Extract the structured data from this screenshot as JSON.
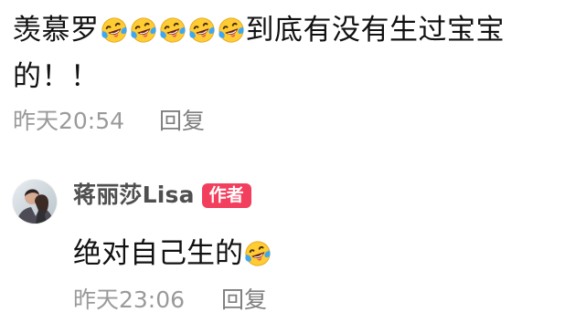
{
  "parent_comment": {
    "segments": [
      {
        "type": "text",
        "value": "羡慕罗"
      },
      {
        "type": "emoji",
        "icon": "laughing-tears-emoji"
      },
      {
        "type": "emoji",
        "icon": "laughing-tears-emoji"
      },
      {
        "type": "emoji",
        "icon": "laughing-tears-emoji"
      },
      {
        "type": "emoji",
        "icon": "laughing-tears-emoji"
      },
      {
        "type": "emoji",
        "icon": "laughing-tears-emoji"
      },
      {
        "type": "text",
        "value": "到底有没有生过宝宝的！！"
      }
    ],
    "timestamp": "昨天20:54",
    "reply_label": "回复"
  },
  "reply_comment": {
    "author_name": "蒋丽莎Lisa",
    "author_badge": "作者",
    "segments": [
      {
        "type": "text",
        "value": "绝对自己生的"
      },
      {
        "type": "emoji",
        "icon": "laughing-tears-emoji"
      }
    ],
    "timestamp": "昨天23:06",
    "reply_label": "回复"
  },
  "colors": {
    "badge": "#f23f5d",
    "meta_text": "#9a9a9a",
    "body_text": "#111111",
    "author_text": "#4f4f4f",
    "emoji_yellow": "#ffcc33",
    "emoji_tear": "#3ea7f2"
  }
}
